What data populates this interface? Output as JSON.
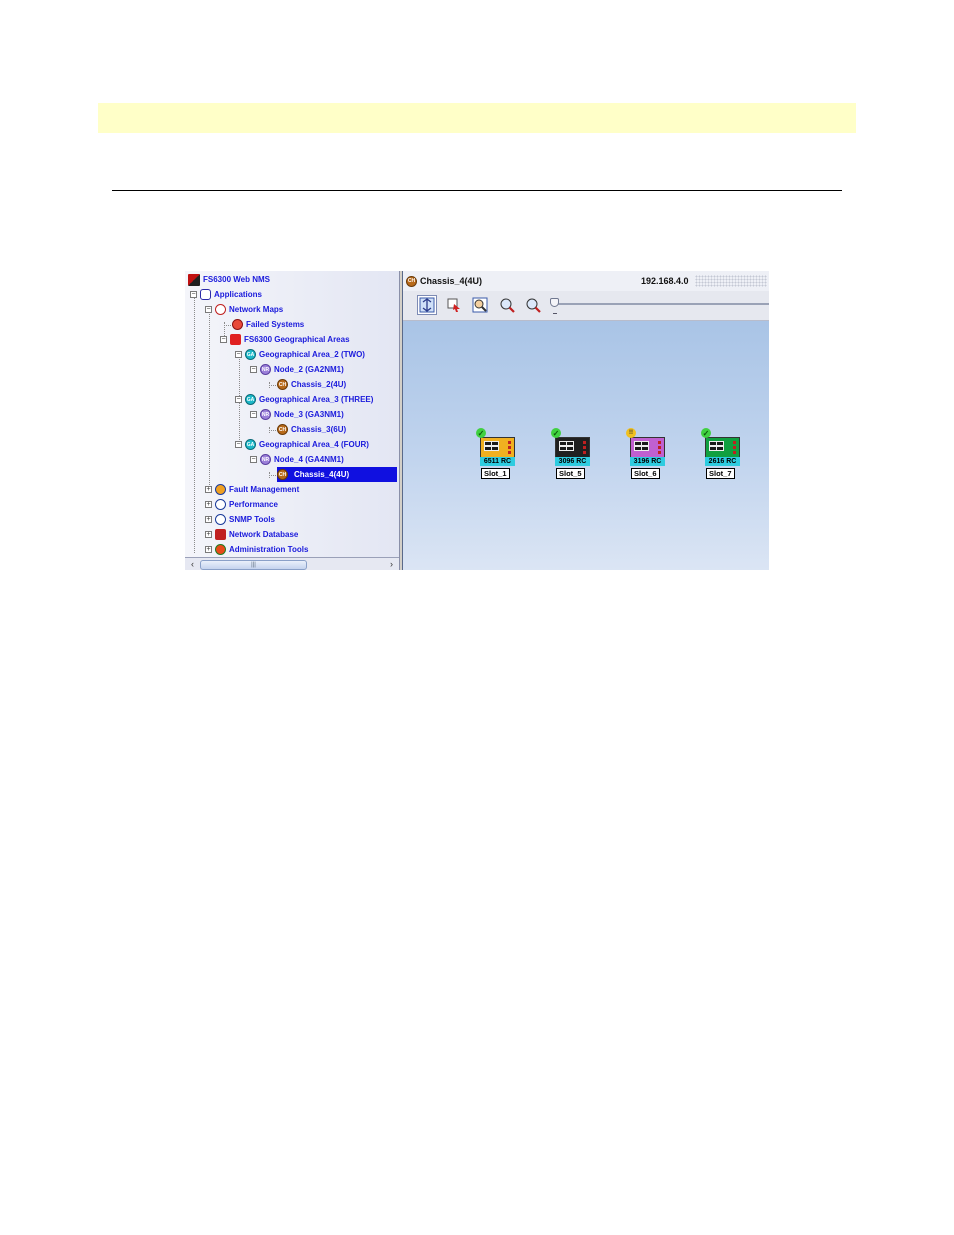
{
  "tree": {
    "root": "FS6300 Web NMS",
    "items": [
      {
        "label": "Applications"
      },
      {
        "label": "Network Maps"
      },
      {
        "label": "Failed Systems"
      },
      {
        "label": "FS6300 Geographical Areas"
      },
      {
        "label": "Geographical Area_2 (TWO)"
      },
      {
        "label": "Node_2 (GA2NM1)"
      },
      {
        "label": "Chassis_2(4U)"
      },
      {
        "label": "Geographical Area_3 (THREE)"
      },
      {
        "label": "Node_3 (GA3NM1)"
      },
      {
        "label": "Chassis_3(6U)"
      },
      {
        "label": "Geographical Area_4 (FOUR)"
      },
      {
        "label": "Node_4 (GA4NM1)"
      },
      {
        "label": "Chassis_4(4U)"
      },
      {
        "label": "Fault Management"
      },
      {
        "label": "Performance"
      },
      {
        "label": "SNMP Tools"
      },
      {
        "label": "Network Database"
      },
      {
        "label": "Administration Tools"
      }
    ],
    "icon_text": {
      "ga": "GA",
      "nd": "NR",
      "ch": "CH"
    },
    "selected": "Chassis_4(4U)",
    "scroll_thumb_mark": "|||"
  },
  "map": {
    "title": "Chassis_4(4U)",
    "title_icon_text": "CH",
    "ip": "192.168.4.0",
    "toolbar_icons": [
      "pan-icon",
      "select-icon",
      "fit-view-icon",
      "zoom-in-icon",
      "zoom-out-icon"
    ],
    "cards": [
      {
        "model": "6511 RC",
        "slot": "Slot_1",
        "color": "#f0b020",
        "status": "ok",
        "status_text": "✓"
      },
      {
        "model": "3096 RC",
        "slot": "Slot_5",
        "color": "#202020",
        "status": "ok",
        "status_text": "✓"
      },
      {
        "model": "3196 RC",
        "slot": "Slot_6",
        "color": "#c060d0",
        "status": "warn",
        "status_text": "!!"
      },
      {
        "model": "2616 RC",
        "slot": "Slot_7",
        "color": "#10a040",
        "status": "ok",
        "status_text": "✓"
      }
    ]
  }
}
